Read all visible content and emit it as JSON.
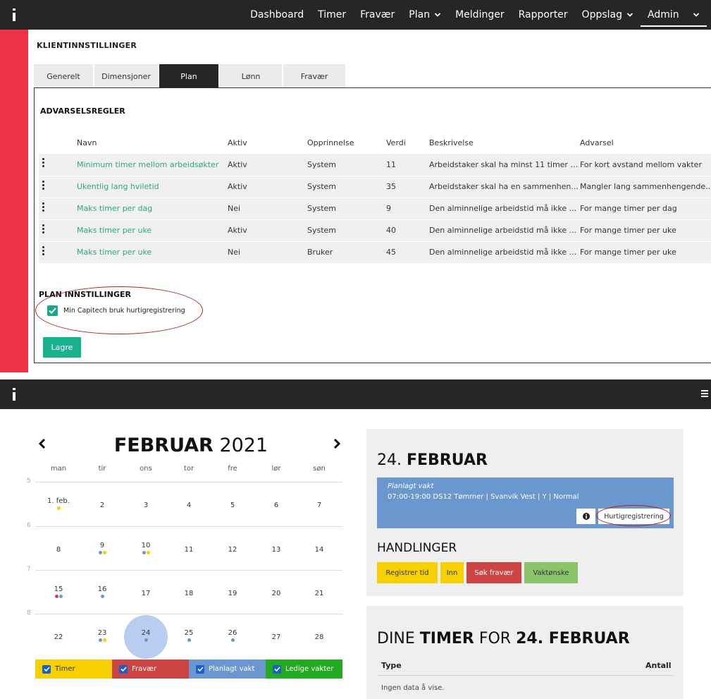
{
  "top_app": {
    "nav": [
      {
        "label": "Dashboard",
        "dropdown": false
      },
      {
        "label": "Timer",
        "dropdown": false
      },
      {
        "label": "Fravær",
        "dropdown": false
      },
      {
        "label": "Plan",
        "dropdown": true
      },
      {
        "label": "Meldinger",
        "dropdown": false
      },
      {
        "label": "Rapporter",
        "dropdown": false
      },
      {
        "label": "Oppslag",
        "dropdown": true
      },
      {
        "label": "Admin",
        "dropdown": true
      }
    ],
    "page_title": "KLIENTINNSTILLINGER",
    "tabs": [
      "Generelt",
      "Dimensjoner",
      "Plan",
      "Lønn",
      "Fravær"
    ],
    "active_tab": "Plan",
    "warnings_title": "ADVARSELSREGLER",
    "columns": [
      "Navn",
      "Aktiv",
      "Opprinnelse",
      "Verdi",
      "Beskrivelse",
      "Advarsel"
    ],
    "rules": [
      {
        "name": "Minimum timer mellom arbeidsøkter",
        "aktiv": "Aktiv",
        "origin": "System",
        "value": "11",
        "description": "Arbeidstaker skal ha minst 11 timer s...",
        "warning": "For kort avstand mellom vakter"
      },
      {
        "name": "Ukentlig lang hviletid",
        "aktiv": "Aktiv",
        "origin": "System",
        "value": "35",
        "description": "Arbeidstaker skal ha en sammenhen...",
        "warning": "Mangler lang sammenhengende hv"
      },
      {
        "name": "Maks timer per dag",
        "aktiv": "Nei",
        "origin": "System",
        "value": "9",
        "description": "Den alminnelige arbeidstid må ikke ...",
        "warning": "For mange timer per dag"
      },
      {
        "name": "Maks timer per uke",
        "aktiv": "Aktiv",
        "origin": "System",
        "value": "40",
        "description": "Den alminnelige arbeidstid må ikke ...",
        "warning": "For mange timer per uke"
      },
      {
        "name": "Maks timer per uke",
        "aktiv": "Nei",
        "origin": "Bruker",
        "value": "45",
        "description": "Den alminnelige arbeidstid må ikke ...",
        "warning": "For mange timer per uke"
      }
    ],
    "plan_settings_title": "PLAN INNSTILLINGER",
    "checkbox_label": "Min Capitech bruk hurtigregistrering",
    "checkbox_checked": true,
    "save_label": "Lagre"
  },
  "calendar": {
    "month": "FEBRUAR",
    "year": "2021",
    "weekdays": [
      "man",
      "tir",
      "ons",
      "tor",
      "fre",
      "lør",
      "søn"
    ],
    "hours": [
      "5",
      "6",
      "7",
      "8"
    ],
    "weeks": [
      [
        "1. feb.",
        "2",
        "3",
        "4",
        "5",
        "6",
        "7"
      ],
      [
        "8",
        "9",
        "10",
        "11",
        "12",
        "13",
        "14"
      ],
      [
        "15",
        "16",
        "17",
        "18",
        "19",
        "20",
        "21"
      ],
      [
        "22",
        "23",
        "24",
        "25",
        "26",
        "27",
        "28"
      ]
    ],
    "today": "24",
    "legend": [
      {
        "label": "Timer",
        "color": "#f6d000",
        "text_color": "#333333"
      },
      {
        "label": "Fravær",
        "color": "#cc4444",
        "text_color": "#ffffff"
      },
      {
        "label": "Planlagt vakt",
        "color": "#6b97cf",
        "text_color": "#ffffff"
      },
      {
        "label": "Ledige vakter",
        "color": "#22aa22",
        "text_color": "#ffffff"
      }
    ]
  },
  "day_panel": {
    "day_number": "24.",
    "day_month": "FEBRUAR",
    "shift_title": "Planlagt vakt",
    "shift_text": "07:00-19:00 DS12 Tømmer | Svanvik Vest | Y | Normal",
    "quick_reg_label": "Hurtigregistrering",
    "actions_title": "HANDLINGER",
    "actions": [
      {
        "label": "Registrer tid",
        "bg": "#f6d000",
        "fg": "#333333"
      },
      {
        "label": "Inn",
        "bg": "#f6d000",
        "fg": "#333333"
      },
      {
        "label": "Søk fravær",
        "bg": "#cc4444",
        "fg": "#ffffff"
      },
      {
        "label": "Vaktønske",
        "bg": "#8cc46c",
        "fg": "#333333"
      }
    ]
  },
  "hours_panel": {
    "title_pre": "DINE ",
    "title_bold1": "TIMER",
    "title_mid": " FOR ",
    "title_bold2": "24. FEBRUAR",
    "col_type": "Type",
    "col_count": "Antall",
    "empty_text": "Ingen data å vise."
  }
}
